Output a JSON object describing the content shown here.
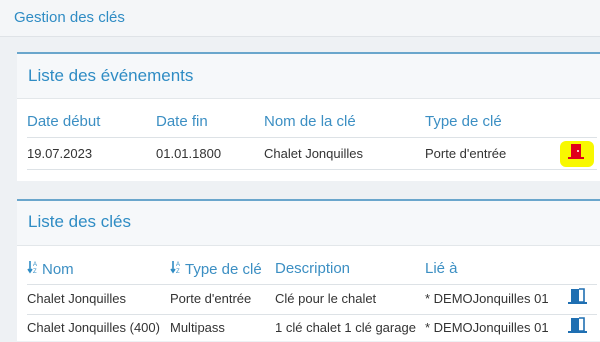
{
  "window": {
    "title": "Gestion des clés"
  },
  "events": {
    "title": "Liste des événements",
    "columns": [
      "Date début",
      "Date fin",
      "Nom de la clé",
      "Type de clé"
    ],
    "rows": [
      {
        "start": "19.07.2023",
        "end": "01.01.1800",
        "key_name": "Chalet Jonquilles",
        "key_type": "Porte d'entrée",
        "action_icon": "door-icon"
      }
    ]
  },
  "keys": {
    "title": "Liste des clés",
    "columns": [
      "Nom",
      "Type de clé",
      "Description",
      "Lié à"
    ],
    "sort_icon_name": "sort-az-icon",
    "rows": [
      {
        "name": "Chalet Jonquilles",
        "type": "Porte d'entrée",
        "description": "Clé pour le chalet",
        "linked": "* DEMOJonquilles 01",
        "action_icon": "exit-door-icon"
      },
      {
        "name": "Chalet Jonquilles (400)",
        "type": "Multipass",
        "description": "1 clé chalet 1 clé garage",
        "linked": "* DEMOJonquilles 01",
        "action_icon": "exit-door-icon"
      }
    ]
  },
  "colors": {
    "accent": "#2f8cc4",
    "highlight": "#f8f800",
    "door_red": "#e0001b",
    "icon_blue": "#1f6fb2"
  }
}
